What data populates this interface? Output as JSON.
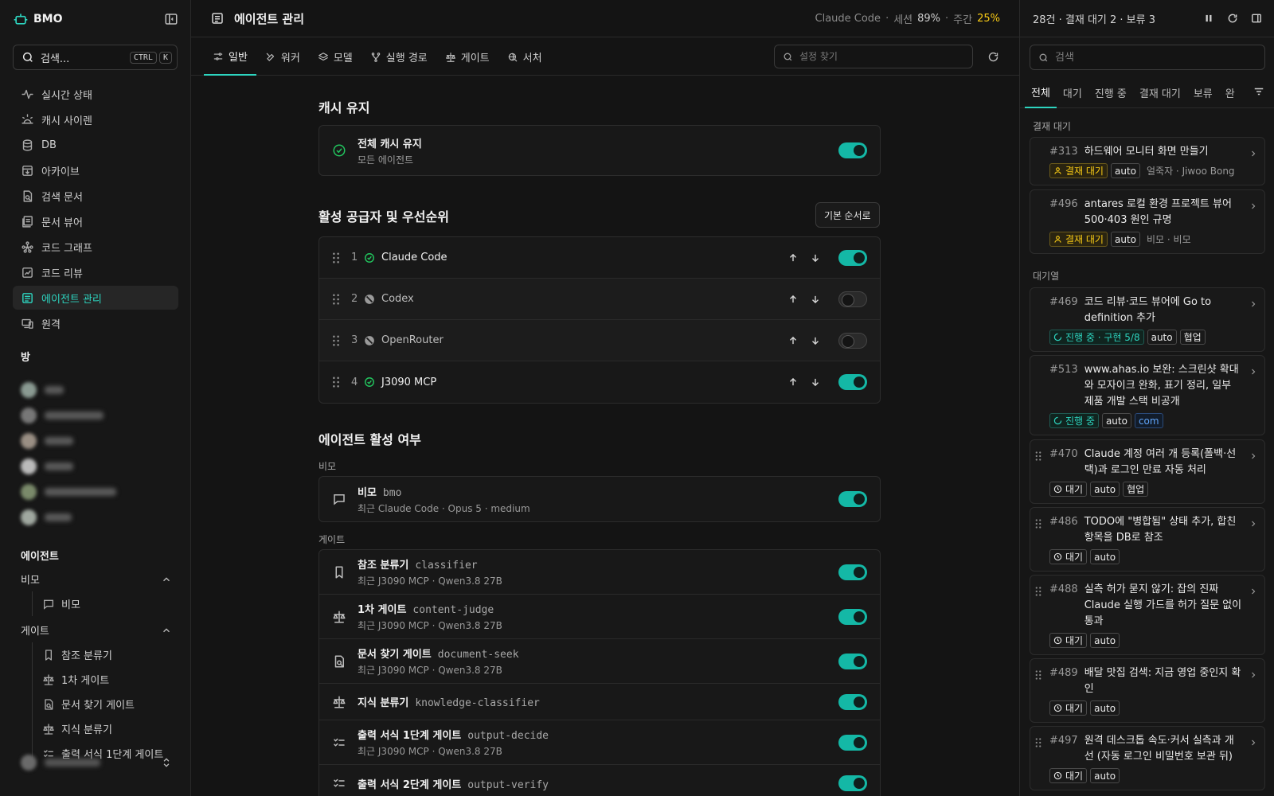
{
  "sidebar": {
    "brand": "BMO",
    "search_label": "검색...",
    "shortcut": [
      "CTRL",
      "K"
    ],
    "nav": [
      {
        "label": "실시간 상태",
        "icon": "activity-icon"
      },
      {
        "label": "캐시 사이렌",
        "icon": "siren-icon"
      },
      {
        "label": "DB",
        "icon": "database-icon"
      },
      {
        "label": "아카이브",
        "icon": "archive-icon"
      },
      {
        "label": "검색 문서",
        "icon": "file-search-icon"
      },
      {
        "label": "문서 뷰어",
        "icon": "library-icon"
      },
      {
        "label": "코드 그래프",
        "icon": "graph-icon"
      },
      {
        "label": "코드 리뷰",
        "icon": "review-icon"
      },
      {
        "label": "에이전트 관리",
        "icon": "list-icon"
      },
      {
        "label": "원격",
        "icon": "devices-icon"
      }
    ],
    "rooms_title": "방",
    "agents_title": "에이전트",
    "group_bimo": "비모",
    "bimo_items": [
      "비모"
    ],
    "group_gate": "게이트",
    "gate_items": [
      "참조 분류기",
      "1차 게이트",
      "문서 찾기 게이트",
      "지식 분류기",
      "출력 서식 1단계 게이트"
    ]
  },
  "header": {
    "title": "에이전트 관리",
    "provider": "Claude Code",
    "sep": "·",
    "session_label": "세션",
    "session_value": "89%",
    "weekly_label": "주간",
    "weekly_value": "25%"
  },
  "tabs": [
    {
      "label": "일반",
      "icon": "sliders-icon"
    },
    {
      "label": "워커",
      "icon": "tools-icon"
    },
    {
      "label": "모델",
      "icon": "layers-icon"
    },
    {
      "label": "실행 경로",
      "icon": "route-icon"
    },
    {
      "label": "게이트",
      "icon": "scale-icon"
    },
    {
      "label": "서처",
      "icon": "globe-search-icon"
    }
  ],
  "settings_search_placeholder": "설정 찾기",
  "cache": {
    "heading": "캐시 유지",
    "title": "전체 캐시 유지",
    "subtitle": "모든 에이전트",
    "enabled": true
  },
  "providers": {
    "heading": "활성 공급자 및 우선순위",
    "default_button": "기본 순서로",
    "items": [
      {
        "num": "1",
        "name": "Claude Code",
        "status": "ok",
        "enabled": true
      },
      {
        "num": "2",
        "name": "Codex",
        "status": "disabled",
        "enabled": false
      },
      {
        "num": "3",
        "name": "OpenRouter",
        "status": "disabled",
        "enabled": false
      },
      {
        "num": "4",
        "name": "J3090 MCP",
        "status": "ok",
        "enabled": true
      }
    ]
  },
  "agents": {
    "heading": "에이전트 활성 여부",
    "bimo_label": "비모",
    "bimo": {
      "name": "비모",
      "code": "bmo",
      "sub": "최근 Claude Code · Opus 5 · medium"
    },
    "gate_label": "게이트",
    "gates": [
      {
        "name": "참조 분류기",
        "code": "classifier",
        "sub": "최근 J3090 MCP · Qwen3.8 27B",
        "icon": "bookmark-icon"
      },
      {
        "name": "1차 게이트",
        "code": "content-judge",
        "sub": "최근 J3090 MCP · Qwen3.8 27B",
        "icon": "scale-icon"
      },
      {
        "name": "문서 찾기 게이트",
        "code": "document-seek",
        "sub": "최근 J3090 MCP · Qwen3.8 27B",
        "icon": "file-search-icon"
      },
      {
        "name": "지식 분류기",
        "code": "knowledge-classifier",
        "sub": "",
        "icon": "scale-icon"
      },
      {
        "name": "출력 서식 1단계 게이트",
        "code": "output-decide",
        "sub": "최근 J3090 MCP · Qwen3.8 27B",
        "icon": "list-check-icon"
      },
      {
        "name": "출력 서식 2단계 게이트",
        "code": "output-verify",
        "sub": "",
        "icon": "list-check-icon"
      }
    ]
  },
  "queue": {
    "summary": "28건 · 결재 대기 2 · 보류 3",
    "search_placeholder": "검색",
    "tabs": [
      "전체",
      "대기",
      "진행 중",
      "결재 대기",
      "보류",
      "완"
    ],
    "approval_title": "결재 대기",
    "queue_title": "대기열",
    "approval": [
      {
        "id": "#313",
        "title": "하드웨어 모니터 화면 만들기",
        "tags": [
          {
            "t": "결재 대기",
            "k": "warn"
          },
          {
            "t": "auto",
            "k": ""
          }
        ],
        "meta": "얼죽자 · Jiwoo Bong"
      },
      {
        "id": "#496",
        "title": "antares 로컬 환경 프로젝트 뷰어 500·403 원인 규명",
        "tags": [
          {
            "t": "결재 대기",
            "k": "warn"
          },
          {
            "t": "auto",
            "k": ""
          }
        ],
        "meta": "비모 · 비모"
      }
    ],
    "queue": [
      {
        "id": "#469",
        "title": "코드 리뷰·코드 뷰어에 Go to definition 추가",
        "tags": [
          {
            "t": "진행 중 · 구현 5/8",
            "k": "prog"
          },
          {
            "t": "auto",
            "k": ""
          },
          {
            "t": "협업",
            "k": ""
          }
        ],
        "drag": false
      },
      {
        "id": "#513",
        "title": "www.ahas.io 보완: 스크린샷 확대와 모자이크 완화, 표기 정리, 일부 제품 개발 스택 비공개",
        "tags": [
          {
            "t": "진행 중",
            "k": "prog"
          },
          {
            "t": "auto",
            "k": ""
          },
          {
            "t": "com",
            "k": "com"
          }
        ],
        "drag": false
      },
      {
        "id": "#470",
        "title": "Claude 계정 여러 개 등록(폴백·선택)과 로그인 만료 자동 처리",
        "tags": [
          {
            "t": "대기",
            "k": "wait"
          },
          {
            "t": "auto",
            "k": ""
          },
          {
            "t": "협업",
            "k": ""
          }
        ],
        "drag": true
      },
      {
        "id": "#486",
        "title": "TODO에 \"병합됨\" 상태 추가, 합친 항목을 DB로 참조",
        "tags": [
          {
            "t": "대기",
            "k": "wait"
          },
          {
            "t": "auto",
            "k": ""
          }
        ],
        "drag": true
      },
      {
        "id": "#488",
        "title": "실측 허가 묻지 않기: 잡의 진짜 Claude 실행 가드를 허가 질문 없이 통과",
        "tags": [
          {
            "t": "대기",
            "k": "wait"
          },
          {
            "t": "auto",
            "k": ""
          }
        ],
        "drag": true
      },
      {
        "id": "#489",
        "title": "배달 맛집 검색: 지금 영업 중인지 확인",
        "tags": [
          {
            "t": "대기",
            "k": "wait"
          },
          {
            "t": "auto",
            "k": ""
          }
        ],
        "drag": true
      },
      {
        "id": "#497",
        "title": "원격 데스크톱 속도·커서 실측과 개선 (자동 로그인 비밀번호 보관 뒤)",
        "tags": [
          {
            "t": "대기",
            "k": "wait"
          },
          {
            "t": "auto",
            "k": ""
          }
        ],
        "drag": true
      }
    ]
  }
}
